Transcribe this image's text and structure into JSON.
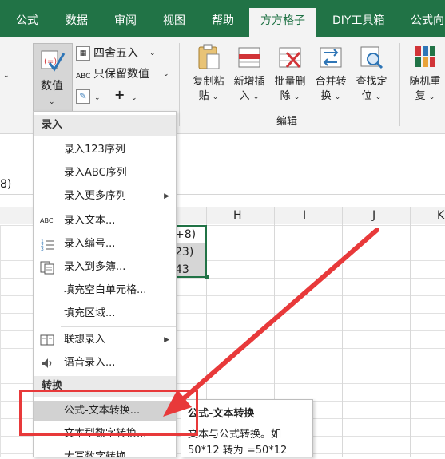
{
  "tabs": [
    "公式",
    "数据",
    "审阅",
    "视图",
    "帮助",
    "方方格子",
    "DIY工具箱",
    "公式向"
  ],
  "ribbon": {
    "numeric_label": "数值",
    "round_label": "四舍五入",
    "keep_value_label": "只保留数值",
    "abc_small": "ABC",
    "plus_symbol": "+",
    "buttons": [
      {
        "line1": "复制粘",
        "line2": "贴"
      },
      {
        "line1": "新增插",
        "line2": "入"
      },
      {
        "line1": "批量删",
        "line2": "除"
      },
      {
        "line1": "合并转",
        "line2": "换"
      },
      {
        "line1": "查找定",
        "line2": "位"
      },
      {
        "line1": "随机重",
        "line2": "复"
      }
    ],
    "group_label": "编辑"
  },
  "formula_bar": {
    "text": "8)"
  },
  "columns": [
    "H",
    "I",
    "J",
    "K"
  ],
  "cells": [
    "+8)",
    "23)",
    "43"
  ],
  "menu": {
    "section_entry": "录入",
    "items": [
      {
        "label": "录入123序列",
        "icon": "",
        "arrow": false
      },
      {
        "label": "录入ABC序列",
        "icon": "",
        "arrow": false
      },
      {
        "label": "录入更多序列",
        "icon": "",
        "arrow": true
      },
      {
        "label": "录入文本...",
        "icon": "abc-text-icon",
        "arrow": false
      },
      {
        "label": "录入编号...",
        "icon": "numbered-list-icon",
        "arrow": false
      },
      {
        "label": "录入到多簿...",
        "icon": "multi-workbook-icon",
        "arrow": false
      },
      {
        "label": "填充空白单元格...",
        "icon": "",
        "arrow": false
      },
      {
        "label": "填充区域...",
        "icon": "",
        "arrow": false
      },
      {
        "label": "联想录入",
        "icon": "book-icon",
        "arrow": true
      },
      {
        "label": "语音录入...",
        "icon": "speaker-icon",
        "arrow": false
      }
    ],
    "section_convert": "转换",
    "convert_items": [
      {
        "label": "公式-文本转换..."
      },
      {
        "label": "文本型数字转换..."
      },
      {
        "label": "大写数字转换"
      }
    ],
    "abc_icon_text": "ABC"
  },
  "tooltip": {
    "title": "公式-文本转换",
    "body_line1": "文本与公式转换。如",
    "body_line2": "50*12 转为 =50*12"
  },
  "colors": {
    "excel_green": "#217346",
    "annotation_red": "#e8393a",
    "highlight": "#d2d2d2"
  }
}
